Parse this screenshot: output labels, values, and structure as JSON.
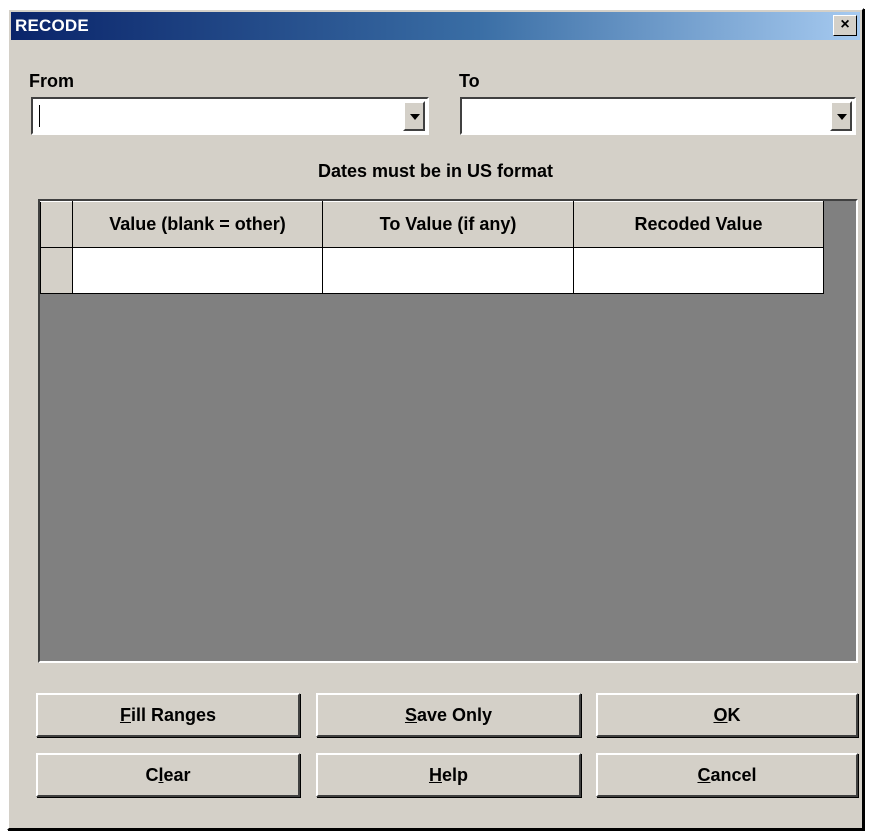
{
  "window": {
    "title": "RECODE",
    "close_label": "×"
  },
  "from": {
    "label": "From",
    "value": ""
  },
  "to": {
    "label": "To",
    "value": ""
  },
  "note": "Dates must be in US format",
  "table": {
    "columns": [
      "Value (blank = other)",
      "To Value (if any)",
      "Recoded Value"
    ],
    "rows": [
      [
        "",
        "",
        ""
      ]
    ]
  },
  "buttons": {
    "fill_ranges": {
      "accel": "F",
      "rest": "ill Ranges"
    },
    "save_only": {
      "accel": "S",
      "rest": "ave Only"
    },
    "ok": {
      "accel": "O",
      "rest": "K"
    },
    "clear": {
      "pre": "C",
      "accel": "l",
      "rest": "ear"
    },
    "help": {
      "accel": "H",
      "rest": "elp"
    },
    "cancel": {
      "accel": "C",
      "rest": "ancel"
    }
  }
}
